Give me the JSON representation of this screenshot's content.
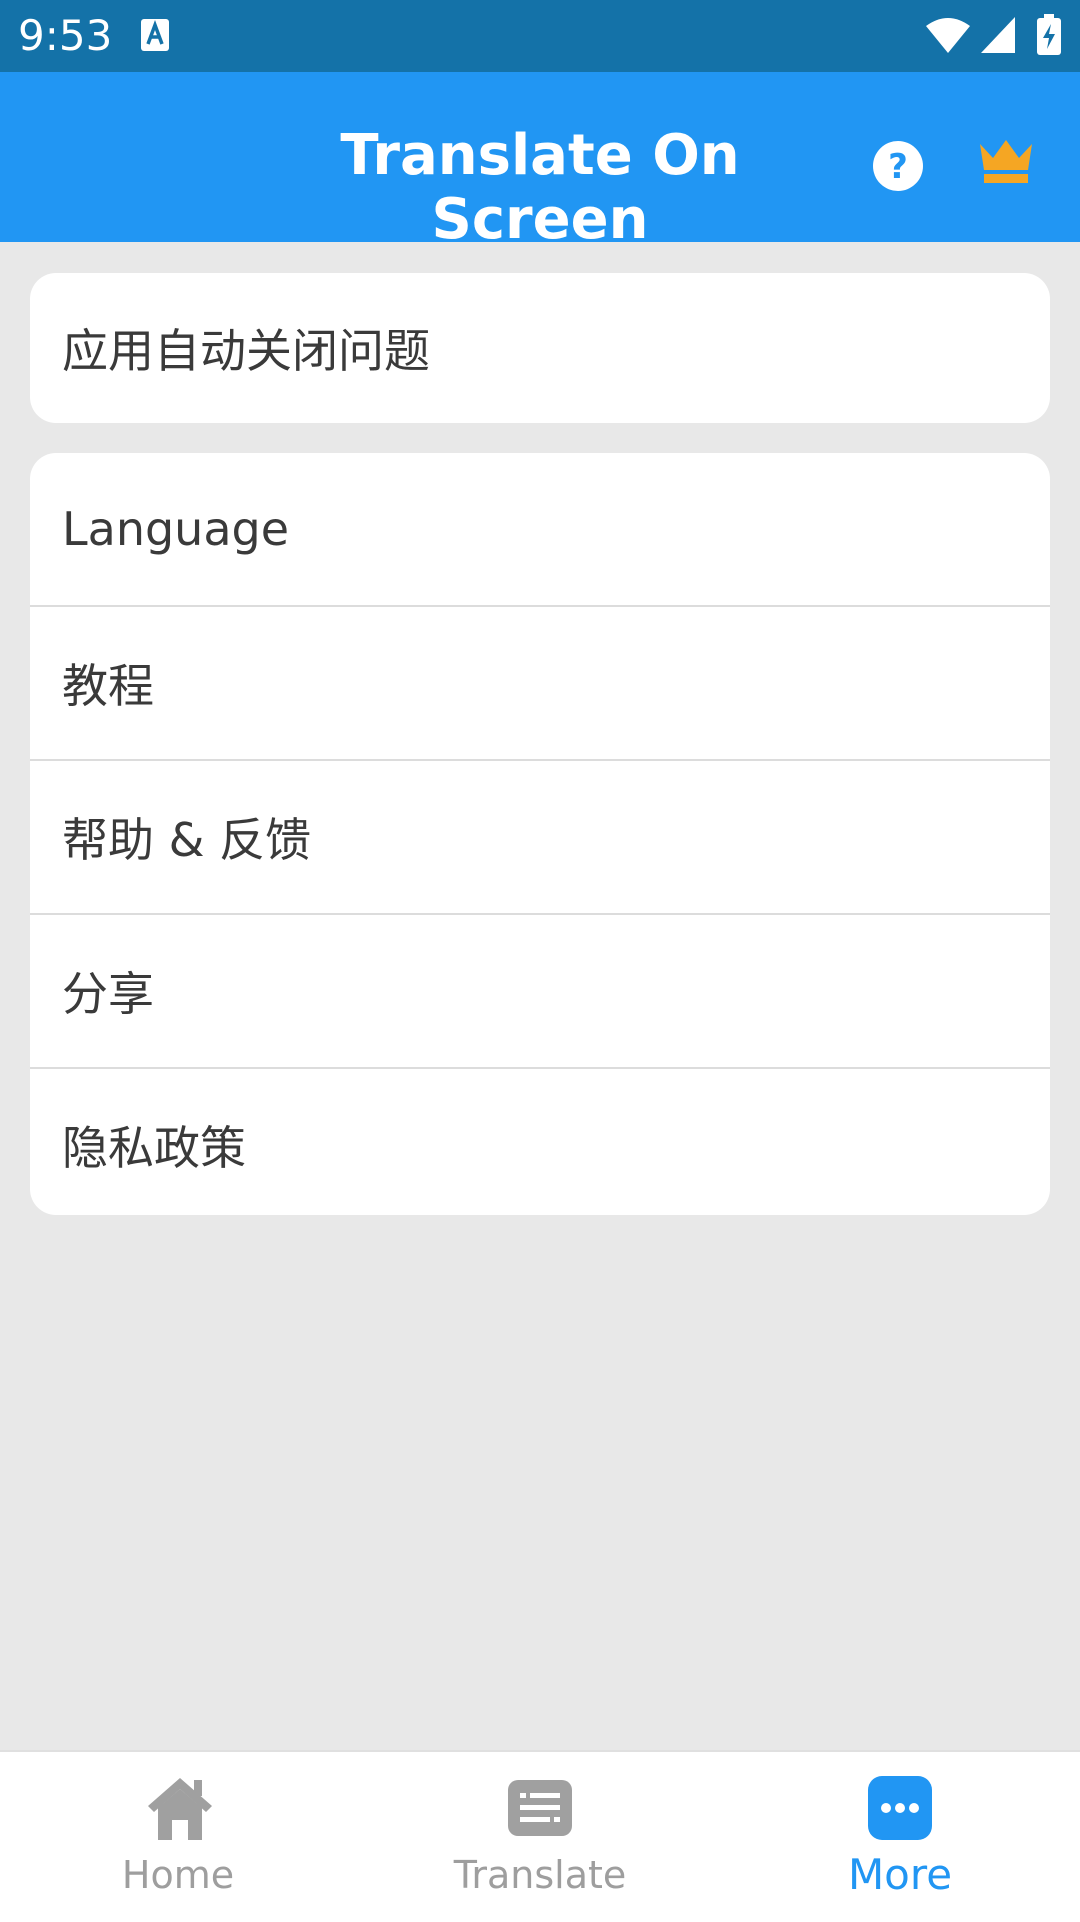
{
  "status_bar": {
    "time": "9:53"
  },
  "app_bar": {
    "title": "Translate On Screen"
  },
  "card_top": {
    "item": "应用自动关闭问题"
  },
  "menu": {
    "items": [
      {
        "label": "Language"
      },
      {
        "label": "教程"
      },
      {
        "label": "帮助 & 反馈"
      },
      {
        "label": "分享"
      },
      {
        "label": "隐私政策"
      }
    ]
  },
  "bottom_nav": {
    "items": [
      {
        "label": "Home",
        "icon": "home-icon"
      },
      {
        "label": "Translate",
        "icon": "translate-icon"
      },
      {
        "label": "More",
        "icon": "more-icon",
        "selected": true
      }
    ]
  },
  "colors": {
    "status_bar": "#1472a8",
    "app_bar": "#2196f3",
    "accent": "#2196f3",
    "crown": "#f5a623",
    "background": "#e8e8e8",
    "inactive_nav": "#9e9e9e"
  }
}
